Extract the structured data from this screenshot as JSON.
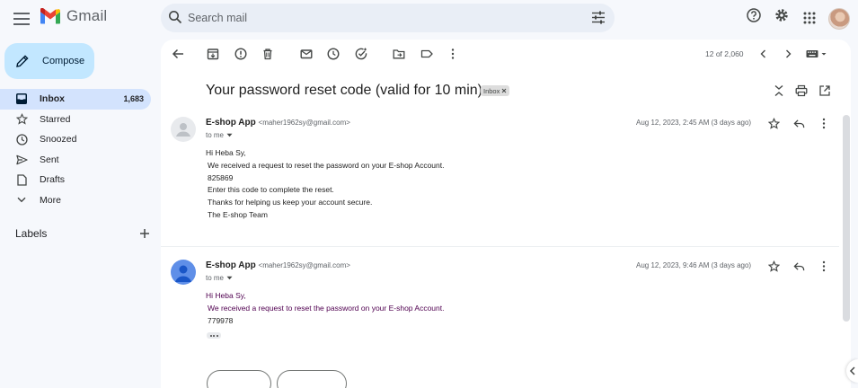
{
  "app": {
    "logo_text": "Gmail"
  },
  "search": {
    "placeholder": "Search mail"
  },
  "sidebar": {
    "compose_label": "Compose",
    "items": [
      {
        "label": "Inbox",
        "count": "1,683",
        "icon": "inbox-icon"
      },
      {
        "label": "Starred",
        "count": "",
        "icon": "star-icon"
      },
      {
        "label": "Snoozed",
        "count": "",
        "icon": "clock-icon"
      },
      {
        "label": "Sent",
        "count": "",
        "icon": "send-icon"
      },
      {
        "label": "Drafts",
        "count": "",
        "icon": "draft-icon"
      },
      {
        "label": "More",
        "count": "",
        "icon": "chevron-down-icon"
      }
    ],
    "labels_header": "Labels"
  },
  "toolbar": {
    "pager_text": "12 of 2,060"
  },
  "thread": {
    "subject": "Your password reset code (valid for 10 min)",
    "label_chip": "Inbox",
    "messages": [
      {
        "sender_name": "E-shop App",
        "sender_email": "<maher1962sy@gmail.com>",
        "to": "to me",
        "date": "Aug 12, 2023, 2:45 AM (3 days ago)",
        "lines": [
          "Hi Heba Sy,",
          "We received a request to reset the password on your E-shop Account.",
          "825869",
          "Enter this code to complete the reset.",
          "Thanks for helping us keep your account secure.",
          "The E-shop Team"
        ]
      },
      {
        "sender_name": "E-shop App",
        "sender_email": "<maher1962sy@gmail.com>",
        "to": "to me",
        "date": "Aug 12, 2023, 9:46 AM (3 days ago)",
        "lines": [
          "Hi Heba Sy,",
          "We received a request to reset the password on your E-shop Account.",
          "779978"
        ]
      }
    ]
  },
  "colors": {
    "compose_bg": "#c2e7ff",
    "active_nav_bg": "#d3e3fd",
    "quoted_text": "#500050",
    "avatar_blue": "#5f8fe8"
  }
}
